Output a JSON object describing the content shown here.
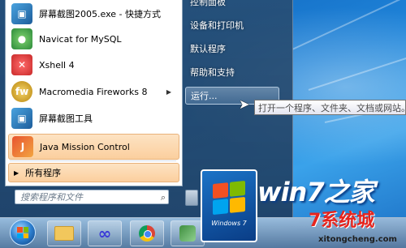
{
  "start_menu": {
    "pinned_programs": [
      {
        "label": "屏幕截图2005.exe - 快捷方式",
        "icon": "screenshot-icon",
        "has_submenu": false,
        "highlighted": false
      },
      {
        "label": "Navicat for MySQL",
        "icon": "navicat-icon",
        "has_submenu": false,
        "highlighted": false
      },
      {
        "label": "Xshell 4",
        "icon": "xshell-icon",
        "has_submenu": false,
        "highlighted": false
      },
      {
        "label": "Macromedia Fireworks 8",
        "icon": "fireworks-icon",
        "has_submenu": true,
        "highlighted": false
      },
      {
        "label": "屏幕截图工具",
        "icon": "screenshot-tool-icon",
        "has_submenu": false,
        "highlighted": false
      },
      {
        "label": "Java Mission Control",
        "icon": "java-mission-control-icon",
        "has_submenu": false,
        "highlighted": true
      }
    ],
    "all_programs_label": "所有程序",
    "search_placeholder": "搜索程序和文件",
    "right_items": [
      {
        "label": "控制面板"
      },
      {
        "label": "设备和打印机"
      },
      {
        "label": "默认程序"
      },
      {
        "label": "帮助和支持"
      }
    ],
    "run_label": "运行...",
    "run_tooltip": "打开一个程序、文件夹、文档或网站。"
  },
  "taskbar": {
    "buttons": [
      {
        "name": "explorer-icon"
      },
      {
        "name": "infinity-app-icon"
      },
      {
        "name": "chrome-icon"
      },
      {
        "name": "app-icon"
      }
    ]
  },
  "watermark": {
    "logo_text": "Windows 7",
    "title": "win7之家",
    "subtitle": "7系统城",
    "url": "xitongcheng.com"
  },
  "colors": {
    "highlight": "#fbcf9e",
    "desktop_blue": "#1f84d9",
    "watermark_red": "#e6251e"
  }
}
